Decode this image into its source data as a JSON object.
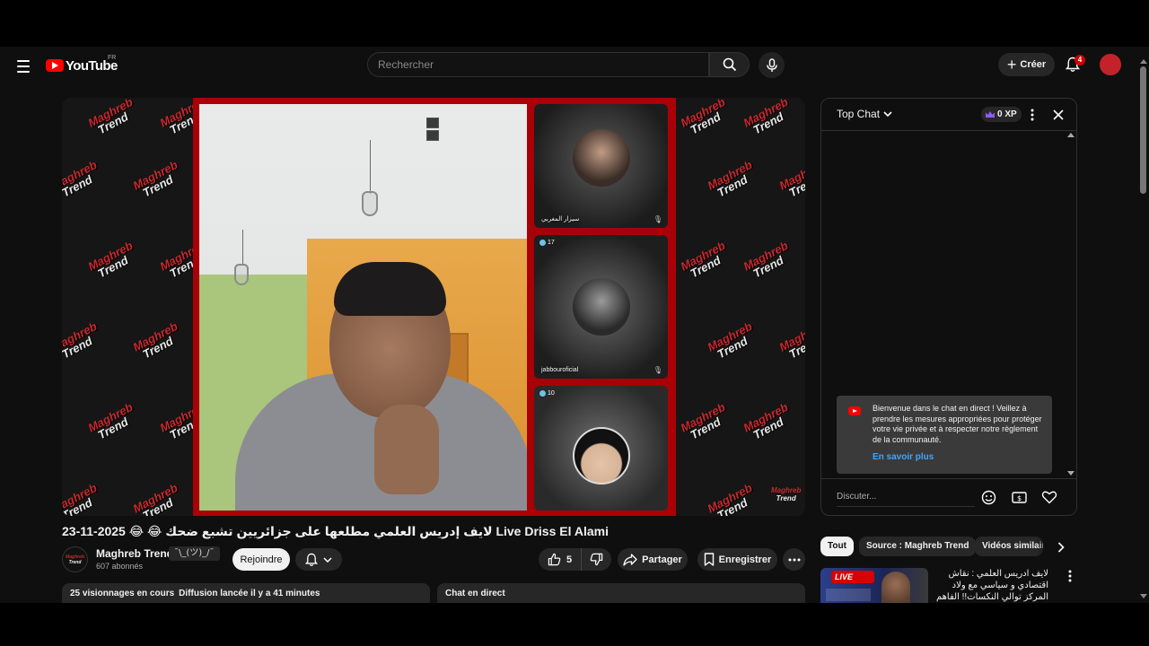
{
  "header": {
    "logo_text": "YouTube",
    "region": "FR",
    "search_placeholder": "Rechercher",
    "create_label": "Créer",
    "notification_count": "4"
  },
  "player": {
    "watermark_line1": "Maghreb",
    "watermark_line2": "Trend",
    "tiles": [
      {
        "name": "سيزار المغربي",
        "count": ""
      },
      {
        "name": "jabbouroficial",
        "count": "17"
      },
      {
        "name": "",
        "count": "10"
      }
    ]
  },
  "video": {
    "title": "23-11-2025 😂 😂 لايف إدريس العلمي مطلعها على جزائريين تشبع ضحك Live Driss El Alami",
    "channel_name": "Maghreb Trend",
    "channel_tag": "¯\\_(ツ)_/¯",
    "subscribers": "607 abonnés",
    "join_label": "Rejoindre",
    "likes": "5",
    "share_label": "Partager",
    "save_label": "Enregistrer",
    "views": "25 visionnages en cours",
    "started": "Diffusion lancée il y a 41 minutes",
    "chat_replay_label": "Chat en direct"
  },
  "chat": {
    "mode_label": "Top Chat",
    "xp_label": "0 XP",
    "welcome_text": "Bienvenue dans le chat en direct ! Veillez à prendre les mesures appropriées pour protéger votre vie privée et à respecter notre règlement de la communauté.",
    "learn_more": "En savoir plus",
    "input_placeholder": "Discuter..."
  },
  "chips": [
    "Tout",
    "Source : Maghreb Trend",
    "Vidéos similaires"
  ],
  "recommendation": {
    "badge": "LIVE",
    "title": "لايف ادريس العلمي : نقاش اقتصادي و سياسي مع ولاد المركز توالي النكسات!! الفاهم يفهم السعودي و الورقة المغربية"
  },
  "colors": {
    "brand_red": "#ff0000",
    "background": "#0f0f0f",
    "link_blue": "#3ea6ff"
  }
}
